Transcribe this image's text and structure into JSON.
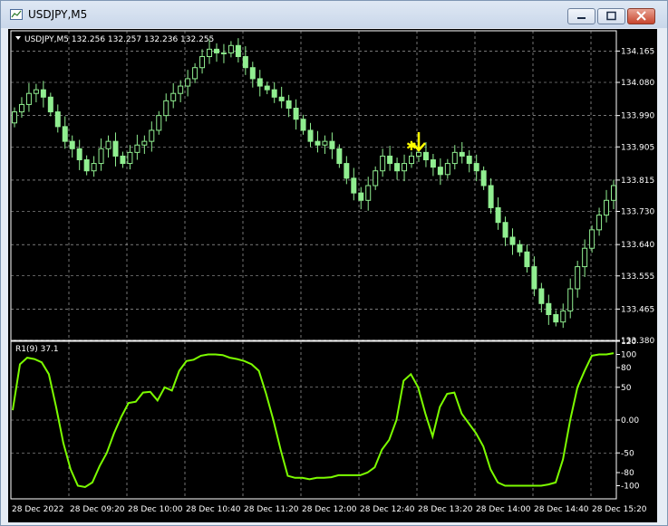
{
  "window": {
    "title": "USDJPY,M5",
    "buttons": {
      "minimize": "minimize",
      "maximize": "maximize",
      "close": "close"
    }
  },
  "main_header": "USDJPY,M5  132.256 132.257 132.236 132.255",
  "indicator_header": "R1(9) 37.1",
  "colors": {
    "background": "#000000",
    "grid": "#c0c0c0",
    "candle": "#90ee90",
    "indicator": "#7cfc00",
    "arrow": "#ffff00",
    "text": "#ffffff"
  },
  "icons": [
    "chart-window-icon",
    "header-dropdown-triangle",
    "sell-arrow-icon",
    "star-marker-icon"
  ],
  "chart_data": [
    {
      "type": "candlestick",
      "yticks": [
        "134.165",
        "134.080",
        "133.990",
        "133.905",
        "133.815",
        "133.730",
        "133.640",
        "133.555",
        "133.465",
        "133.380"
      ],
      "ylim": [
        133.38,
        134.22
      ],
      "xticks": [
        "28 Dec 2022",
        "28 Dec 09:20",
        "28 Dec 10:00",
        "28 Dec 10:40",
        "28 Dec 11:20",
        "28 Dec 12:00",
        "28 Dec 12:40",
        "28 Dec 13:20",
        "28 Dec 14:00",
        "28 Dec 14:40",
        "28 Dec 15:20"
      ],
      "grid": true,
      "close_path": [
        134.0,
        134.02,
        134.05,
        134.06,
        134.04,
        134.0,
        133.96,
        133.92,
        133.9,
        133.87,
        133.84,
        133.86,
        133.9,
        133.92,
        133.88,
        133.86,
        133.89,
        133.91,
        133.92,
        133.95,
        133.99,
        134.03,
        134.05,
        134.07,
        134.09,
        134.12,
        134.15,
        134.17,
        134.16,
        134.16,
        134.18,
        134.15,
        134.12,
        134.09,
        134.07,
        134.06,
        134.04,
        134.03,
        134.01,
        133.98,
        133.95,
        133.92,
        133.91,
        133.92,
        133.9,
        133.86,
        133.82,
        133.78,
        133.76,
        133.8,
        133.84,
        133.88,
        133.86,
        133.84,
        133.86,
        133.88,
        133.89,
        133.87,
        133.85,
        133.83,
        133.86,
        133.89,
        133.88,
        133.86,
        133.84,
        133.8,
        133.74,
        133.7,
        133.66,
        133.64,
        133.62,
        133.58,
        133.52,
        133.48,
        133.45,
        133.43,
        133.46,
        133.52,
        133.58,
        133.63,
        133.68,
        133.72,
        133.76,
        133.8
      ]
    },
    {
      "type": "line",
      "yticks": [
        "120",
        "100",
        "80",
        "50",
        "0.00",
        "-50",
        "-80",
        "-100"
      ],
      "ylim": [
        -120,
        120
      ],
      "values": [
        15,
        85,
        95,
        93,
        88,
        70,
        20,
        -35,
        -75,
        -100,
        -102,
        -95,
        -70,
        -50,
        -20,
        5,
        26,
        28,
        42,
        43,
        30,
        50,
        45,
        75,
        90,
        92,
        98,
        100,
        100,
        99,
        95,
        93,
        90,
        85,
        75,
        40,
        0,
        -45,
        -85,
        -88,
        -88,
        -90,
        -88,
        -88,
        -87,
        -84,
        -84,
        -84,
        -84,
        -80,
        -72,
        -45,
        -30,
        0,
        60,
        70,
        50,
        10,
        -25,
        20,
        40,
        42,
        10,
        -5,
        -20,
        -40,
        -75,
        -95,
        -100,
        -100,
        -100,
        -100,
        -100,
        -100,
        -98,
        -95,
        -60,
        0,
        50,
        75,
        98,
        100,
        100,
        102
      ]
    }
  ]
}
